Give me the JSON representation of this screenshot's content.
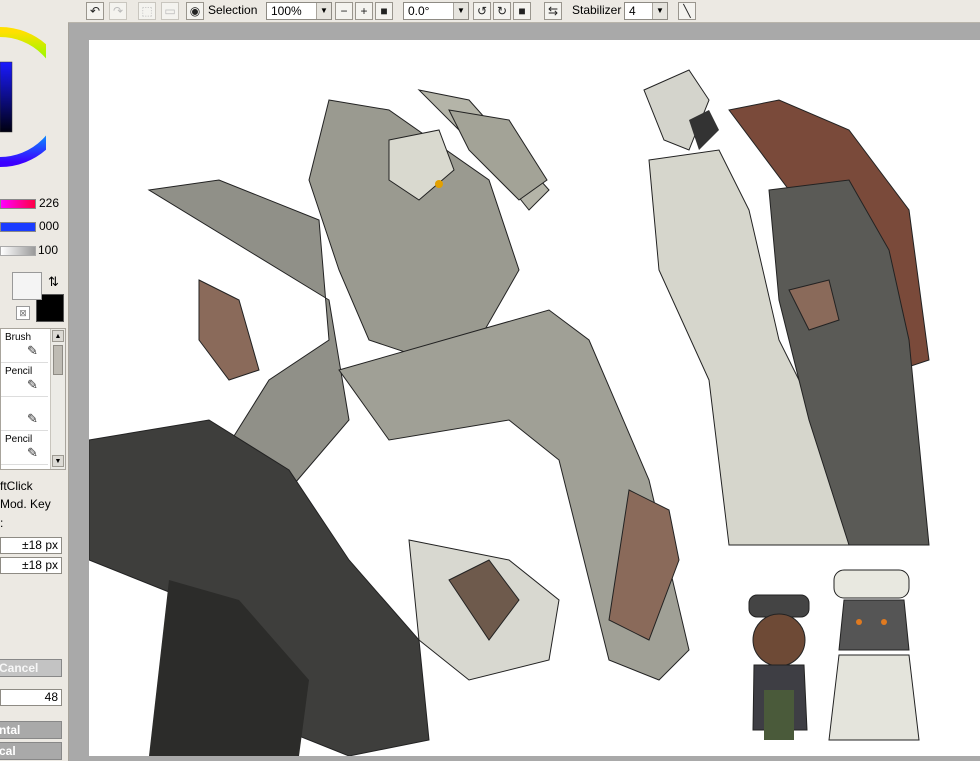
{
  "toolbar": {
    "selection_label": "Selection",
    "zoom_value": "100%",
    "rotation_value": "0.0°",
    "stabilizer_label": "Stabilizer",
    "stabilizer_value": "4",
    "icons": [
      "undo-icon",
      "redo-icon",
      "deselect-icon",
      "invert-icon",
      "eye-icon",
      "zoom-out-icon",
      "zoom-in-icon",
      "zoom-reset-icon",
      "rotate-ccw-icon",
      "rotate-cw-icon",
      "rotate-reset-icon",
      "flip-icon",
      "line-icon"
    ]
  },
  "color_panel": {
    "slider_values": [
      "226",
      "000",
      "100"
    ],
    "slider_colors": [
      "#ff00aa",
      "#1a3cff",
      "#9a9a9a"
    ],
    "foreground_color": "#f4f4f4",
    "background_color": "#000000"
  },
  "tools": [
    {
      "label": "Brush",
      "icon": "brush-icon"
    },
    {
      "label": "Pencil",
      "icon": "pencil-icon"
    },
    {
      "label": "",
      "icon": "pen-icon"
    },
    {
      "label": "Pencil",
      "icon": "pencil-icon"
    }
  ],
  "brush_settings": {
    "shift_click_label": "ftClick",
    "mod_key_label": "Mod. Key",
    "colon_label": ":",
    "width_value": "±18 px",
    "height_value": "±18 px",
    "cancel_label": "Cancel",
    "size_value": "48",
    "horizontal_label": "ntal",
    "vertical_label": "cal"
  }
}
